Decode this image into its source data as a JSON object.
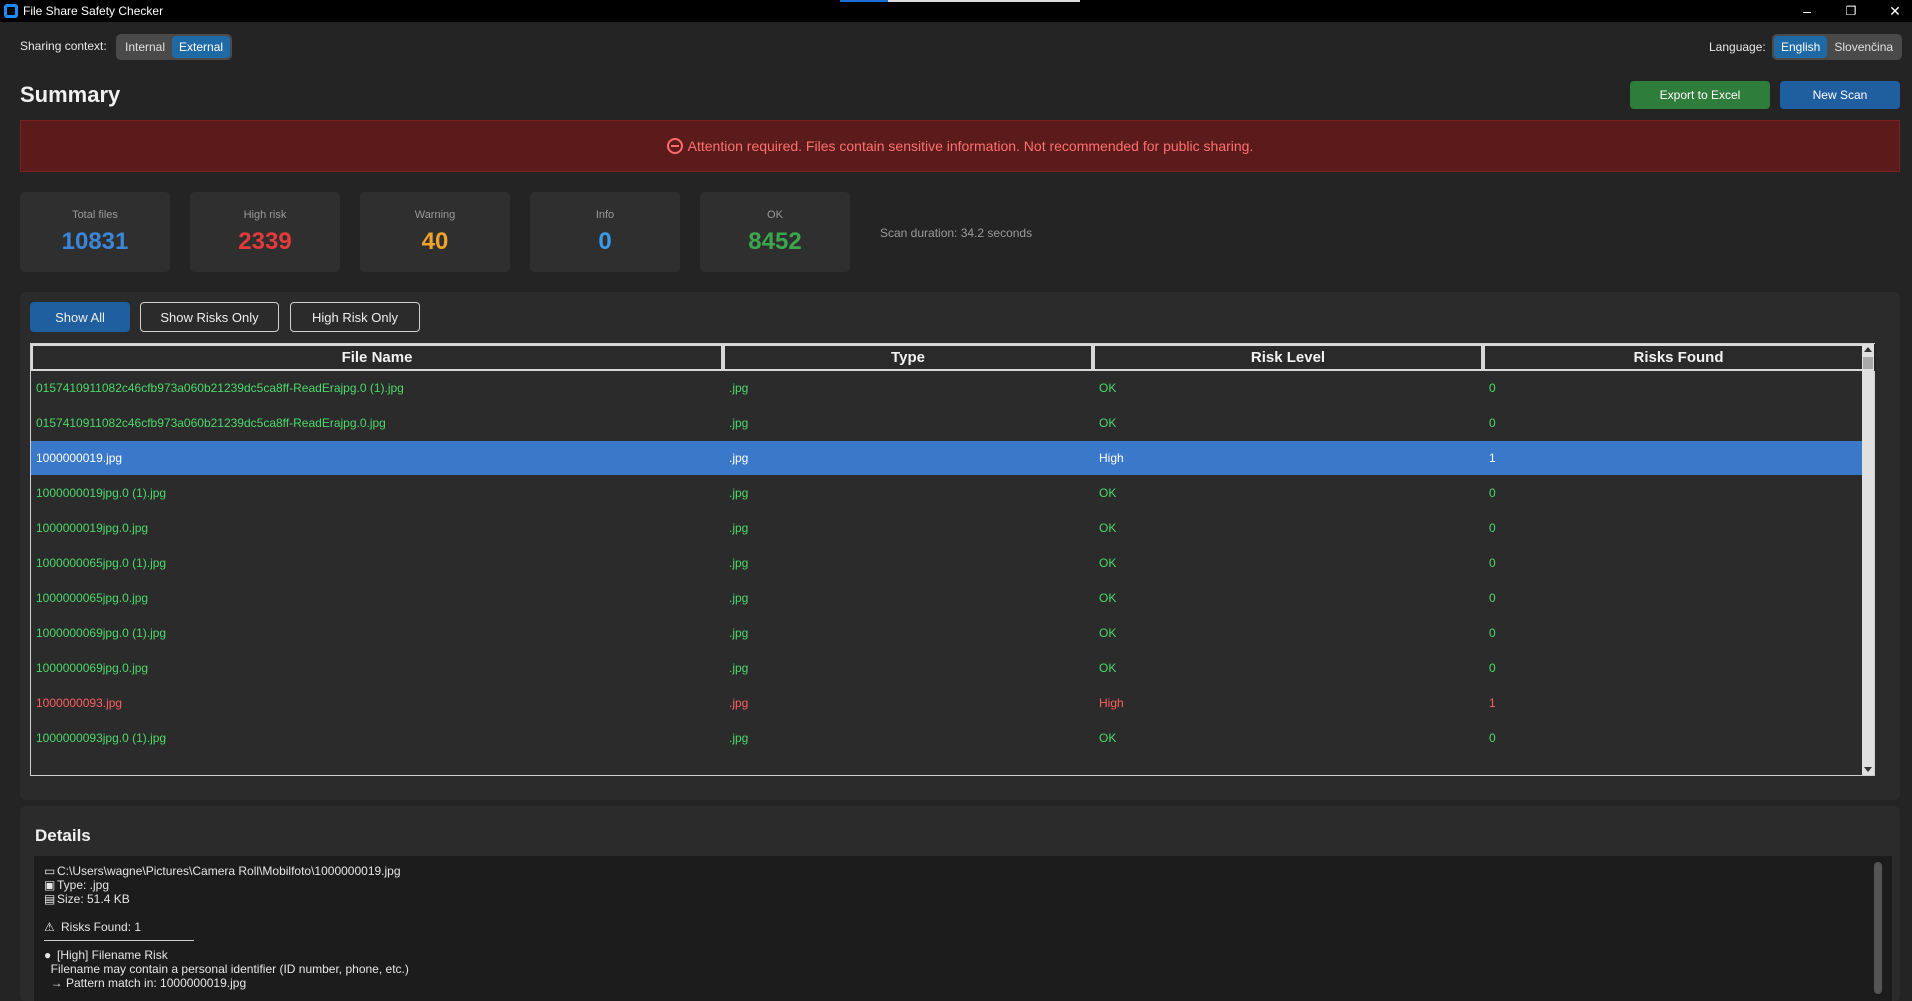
{
  "window": {
    "title": "File Share Safety Checker",
    "minimize": "–",
    "restore": "❐",
    "close": "✕"
  },
  "top": {
    "sharing_label": "Sharing context:",
    "sharing_options": [
      "Internal",
      "External"
    ],
    "sharing_selected": "External",
    "language_label": "Language:",
    "language_options": [
      "English",
      "Slovenčina"
    ],
    "language_selected": "English"
  },
  "summary": {
    "title": "Summary",
    "export_label": "Export to Excel",
    "new_scan_label": "New Scan",
    "alert": "Attention required. Files contain sensitive information. Not recommended for public sharing.",
    "stats": [
      {
        "label": "Total files",
        "value": "10831",
        "color": "#3b86d6"
      },
      {
        "label": "High risk",
        "value": "2339",
        "color": "#e33b3b"
      },
      {
        "label": "Warning",
        "value": "40",
        "color": "#f0a32a"
      },
      {
        "label": "Info",
        "value": "0",
        "color": "#3b9be8"
      },
      {
        "label": "OK",
        "value": "8452",
        "color": "#3aa84a"
      }
    ],
    "scan_duration": "Scan duration: 34.2 seconds"
  },
  "filters": {
    "show_all": "Show All",
    "show_risks": "Show Risks Only",
    "high_risk": "High Risk Only"
  },
  "table": {
    "headers": [
      "File Name",
      "Type",
      "Risk Level",
      "Risks Found"
    ],
    "rows": [
      {
        "name": "0157410911082c46cfb973a060b21239dc5ca8ff-ReadErajpg.0 (1).jpg",
        "type": ".jpg",
        "risk": "OK",
        "found": "0",
        "status": "ok"
      },
      {
        "name": "0157410911082c46cfb973a060b21239dc5ca8ff-ReadErajpg.0.jpg",
        "type": ".jpg",
        "risk": "OK",
        "found": "0",
        "status": "ok"
      },
      {
        "name": "1000000019.jpg",
        "type": ".jpg",
        "risk": "High",
        "found": "1",
        "status": "sel"
      },
      {
        "name": "1000000019jpg.0 (1).jpg",
        "type": ".jpg",
        "risk": "OK",
        "found": "0",
        "status": "ok"
      },
      {
        "name": "1000000019jpg.0.jpg",
        "type": ".jpg",
        "risk": "OK",
        "found": "0",
        "status": "ok"
      },
      {
        "name": "1000000065jpg.0 (1).jpg",
        "type": ".jpg",
        "risk": "OK",
        "found": "0",
        "status": "ok"
      },
      {
        "name": "1000000065jpg.0.jpg",
        "type": ".jpg",
        "risk": "OK",
        "found": "0",
        "status": "ok"
      },
      {
        "name": "1000000069jpg.0 (1).jpg",
        "type": ".jpg",
        "risk": "OK",
        "found": "0",
        "status": "ok"
      },
      {
        "name": "1000000069jpg.0.jpg",
        "type": ".jpg",
        "risk": "OK",
        "found": "0",
        "status": "ok"
      },
      {
        "name": "1000000093.jpg",
        "type": ".jpg",
        "risk": "High",
        "found": "1",
        "status": "high"
      },
      {
        "name": "1000000093jpg.0 (1).jpg",
        "type": ".jpg",
        "risk": "OK",
        "found": "0",
        "status": "ok"
      }
    ]
  },
  "details": {
    "title": "Details",
    "path": "C:\\Users\\wagne\\Pictures\\Camera Roll\\Mobilfoto\\1000000019.jpg",
    "type": "Type: .jpg",
    "size": "Size: 51.4 KB",
    "risks_found": "Risks Found: 1",
    "risk_title": "[High] Filename Risk",
    "risk_desc": "  Filename may contain a personal identifier (ID number, phone, etc.)",
    "risk_match": "  → Pattern match in: 1000000019.jpg"
  }
}
